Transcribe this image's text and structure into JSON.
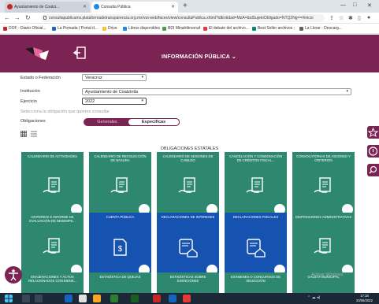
{
  "browser": {
    "tabs": [
      {
        "title": "Ayuntamiento de Coatzi...",
        "active": false
      },
      {
        "title": "Consulta Pública",
        "active": true
      }
    ],
    "url": "consultapublicamx.plataformadetransparencia.org.mx/vut-web/faces/view/consultaPublica.xhtml?idEntidad=MzA=&idSujetoObligado=NTQ2Ng==#inicio",
    "bookmarks": [
      {
        "label": "DOF - Diario Oficial...",
        "color": "#c62828"
      },
      {
        "label": "La Pomada | Portal d...",
        "color": "#1565c0"
      },
      {
        "label": "Drive",
        "color": "#fbc02d"
      },
      {
        "label": "Libros disponibles",
        "color": "#1e88e5"
      },
      {
        "label": "BDI Minahttirsonaf",
        "color": "#43a047"
      },
      {
        "label": "El debate del archivo...",
        "color": "#e53935"
      },
      {
        "label": "Best Seller archivos -",
        "color": "#00897b"
      },
      {
        "label": "La Llorar - Descarg...",
        "color": "#616161"
      }
    ]
  },
  "header": {
    "title": "INFORMACIÓN PÚBLICA",
    "title_caret": "⌄"
  },
  "form": {
    "estado_label": "Estado o Federación",
    "estado_value": "Veracruz",
    "institucion_label": "Institución",
    "institucion_value": "Ayuntamiento de Coatzintla",
    "ejercicio_label": "Ejercicio",
    "ejercicio_value": "2022",
    "hint": "Selecciona la obligación que quieres consultar",
    "obligaciones_label": "Obligaciones",
    "option_generales": "Generales",
    "option_especificas": "Específicas"
  },
  "section_title": "OBLIGACIONES ESTATALES",
  "cards": [
    {
      "title": "CALENDARIO DE ACTIVIDADES",
      "color": "teal",
      "icon": "document-hand-icon"
    },
    {
      "title": "CALENDARIO DE RECOLECCIÓN DE BASURA",
      "color": "teal",
      "icon": "document-hand-icon"
    },
    {
      "title": "CALENDARIO DE SESIONES DE CABILDO",
      "color": "teal",
      "icon": "document-hand-icon"
    },
    {
      "title": "CANCELACIÓN Y CONDONACIÓN DE CRÉDITOS FISCAL...",
      "color": "teal",
      "icon": "document-hand-icon"
    },
    {
      "title": "CONVOCATORIAS DE ASCENSO Y CRITERIOS",
      "color": "teal",
      "icon": "document-hand-icon"
    },
    {
      "title": "CRITERIOS E INFORME DE EVALUACIÓN DE DESEMPE...",
      "color": "teal",
      "icon": "document-hand-icon"
    },
    {
      "title": "CUENTA PÚBLICA",
      "color": "blue",
      "icon": "money-document-icon"
    },
    {
      "title": "DECLARACIONES DE INTERESES",
      "color": "blue",
      "icon": "certificate-house-icon"
    },
    {
      "title": "DECLARACIONES FISCALES",
      "color": "blue",
      "icon": "certificate-house-icon"
    },
    {
      "title": "DISPOSICIONES ADMINISTRATIVAS",
      "color": "teal",
      "icon": "document-hand-icon"
    },
    {
      "title": "ENAJENACIONES Y ACTOS RELACIONADOS CON BIENE...",
      "color": "teal",
      "icon": ""
    },
    {
      "title": "ESTADÍSTICA DE QUEJAS",
      "color": "teal",
      "icon": ""
    },
    {
      "title": "ESTADÍSTICAS SOBRE EXENCIONES",
      "color": "teal",
      "icon": ""
    },
    {
      "title": "EXÁMENES O CONCURSOS DE SELECCIÓN",
      "color": "teal",
      "icon": ""
    },
    {
      "title": "GACETA MUNICIPAL",
      "color": "teal",
      "icon": ""
    }
  ],
  "watermark": "Activar Windows",
  "taskbar": {
    "time": "17:18",
    "date": "20/06/2022"
  },
  "colors": {
    "brand": "#7b2453",
    "teal": "#2e8870",
    "blue": "#1652b0"
  }
}
